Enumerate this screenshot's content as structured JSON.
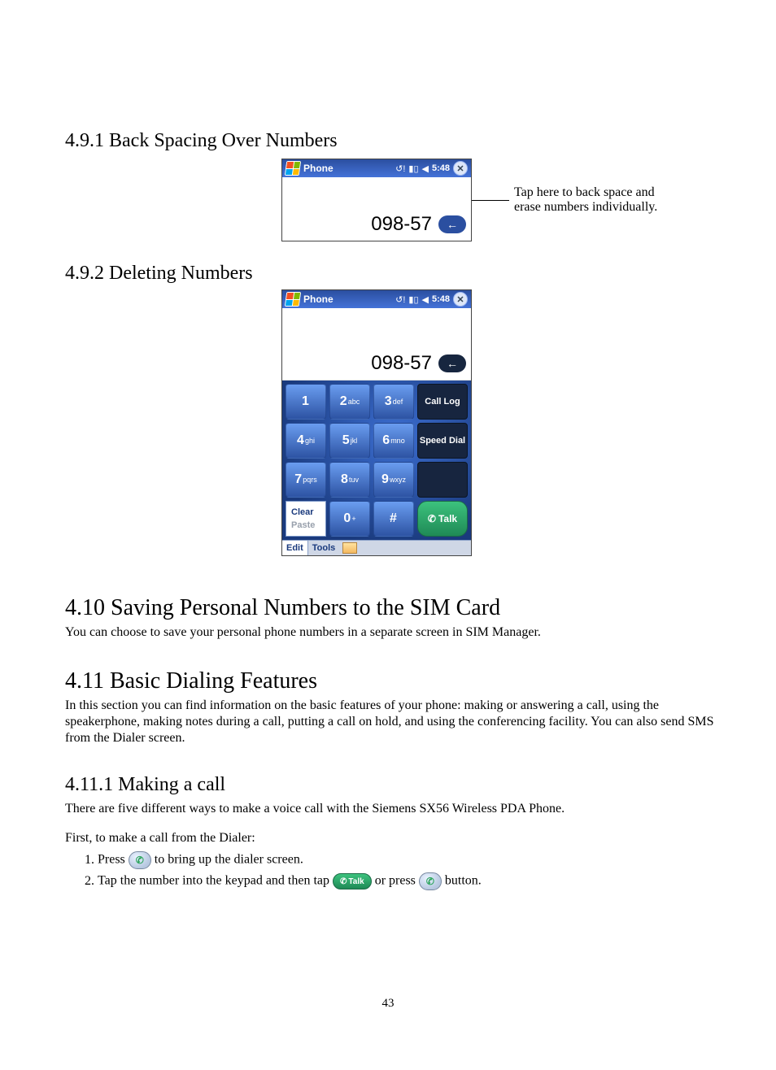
{
  "sections": {
    "s491": {
      "title": "4.9.1 Back Spacing Over Numbers"
    },
    "s492": {
      "title": "4.9.2 Deleting Numbers"
    },
    "s410": {
      "title": "4.10   Saving Personal Numbers to the SIM Card",
      "body": "You can choose to save your personal phone numbers in a separate screen in SIM Manager."
    },
    "s411": {
      "title": "4.11   Basic Dialing Features",
      "body": "In this section you can find information on the basic features of your phone: making or answering a call, using the speakerphone, making notes during a call, putting a call on hold, and using the conferencing facility. You can also send SMS from the Dialer screen."
    },
    "s4111": {
      "title": "4.11.1 Making a call",
      "intro": "There are five different ways to make a voice call with the Siemens SX56 Wireless PDA Phone.",
      "lead": "First, to make a call from the Dialer:",
      "step1_a": "Press ",
      "step1_b": " to bring up the dialer screen.",
      "step2_a": "Tap the number into the keypad and then tap ",
      "step2_b": " or press ",
      "step2_c": " button."
    }
  },
  "callout": {
    "line1": "Tap here to back space and",
    "line2": "erase numbers individually."
  },
  "screenshot1": {
    "title": "Phone",
    "time": "5:48",
    "number": "098-57"
  },
  "screenshot2": {
    "title": "Phone",
    "time": "5:48",
    "number": "098-57",
    "keys": {
      "k1": "1",
      "k2d": "2",
      "k2l": "abc",
      "k3d": "3",
      "k3l": "def",
      "k4d": "4",
      "k4l": "ghi",
      "k5d": "5",
      "k5l": "jkl",
      "k6d": "6",
      "k6l": "mno",
      "k7d": "7",
      "k7l": "pqrs",
      "k8d": "8",
      "k8l": "tuv",
      "k9d": "9",
      "k9l": "wxyz",
      "k0d": "0",
      "k0l": "+",
      "khash": "#",
      "call_log": "Call Log",
      "speed_dial": "Speed Dial",
      "clear": "Clear",
      "paste": "Paste",
      "talk": "Talk"
    },
    "bottombar": {
      "edit": "Edit",
      "tools": "Tools"
    }
  },
  "inline_talk": "Talk",
  "page_number": "43"
}
